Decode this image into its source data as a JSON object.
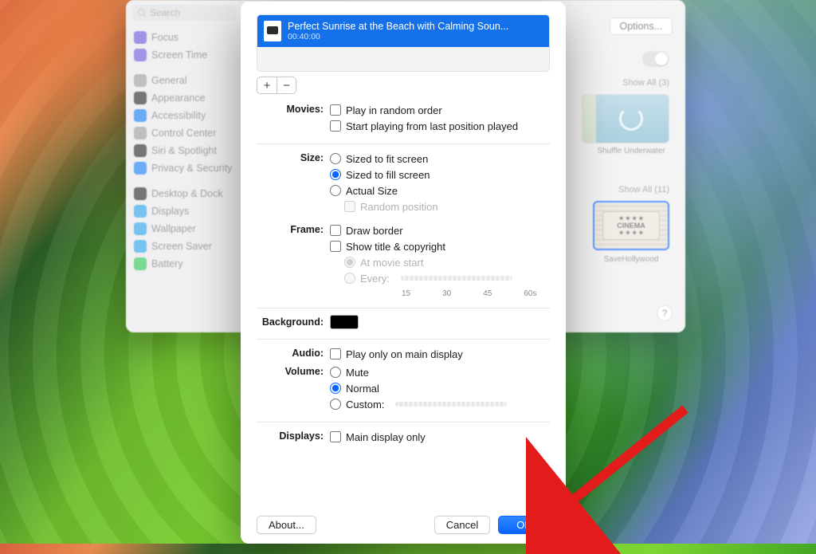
{
  "sidebar": {
    "search_placeholder": "Search",
    "items": [
      {
        "label": "Focus",
        "color": "#6e5bd6"
      },
      {
        "label": "Screen Time",
        "color": "#6e5bd6"
      }
    ],
    "items2": [
      {
        "label": "General",
        "color": "#9d9da0"
      },
      {
        "label": "Appearance",
        "color": "#2c2c2c"
      },
      {
        "label": "Accessibility",
        "color": "#1e7ff0"
      },
      {
        "label": "Control Center",
        "color": "#9d9da0"
      },
      {
        "label": "Siri & Spotlight",
        "color": "#2c2c2c"
      },
      {
        "label": "Privacy & Security",
        "color": "#1e7ff0"
      }
    ],
    "items3": [
      {
        "label": "Desktop & Dock",
        "color": "#2c2c2c"
      },
      {
        "label": "Displays",
        "color": "#2da1e8"
      },
      {
        "label": "Wallpaper",
        "color": "#2da1e8"
      },
      {
        "label": "Screen Saver",
        "color": "#2da1e8"
      },
      {
        "label": "Battery",
        "color": "#34c759"
      }
    ]
  },
  "rightpane": {
    "options": "Options...",
    "showall1": "Show All (3)",
    "thumb1_label": "Shuffle Underwater",
    "showall2": "Show All (11)",
    "thumb2_title": "CINEMA",
    "thumb2_label": "SaveHollywood"
  },
  "sheet": {
    "movie": {
      "title": "Perfect Sunrise at the Beach with Calming Soun...",
      "duration": "00:40:00"
    },
    "add": "+",
    "remove": "−",
    "labels": {
      "movies": "Movies:",
      "size": "Size:",
      "frame": "Frame:",
      "background": "Background:",
      "audio": "Audio:",
      "volume": "Volume:",
      "displays": "Displays:"
    },
    "movies": {
      "random": "Play in random order",
      "resume": "Start playing from last position played"
    },
    "size": {
      "fit": "Sized to fit screen",
      "fill": "Sized to fill screen",
      "actual": "Actual Size",
      "randompos": "Random position"
    },
    "frame": {
      "border": "Draw border",
      "title": "Show title & copyright",
      "atstart": "At movie start",
      "every": "Every:"
    },
    "ticks": {
      "t1": "15",
      "t2": "30",
      "t3": "45",
      "t4": "60s"
    },
    "audio": {
      "main": "Play only on main display"
    },
    "volume": {
      "mute": "Mute",
      "normal": "Normal",
      "custom": "Custom:"
    },
    "displays": {
      "main": "Main display only"
    },
    "buttons": {
      "about": "About...",
      "cancel": "Cancel",
      "ok": "OK"
    }
  }
}
